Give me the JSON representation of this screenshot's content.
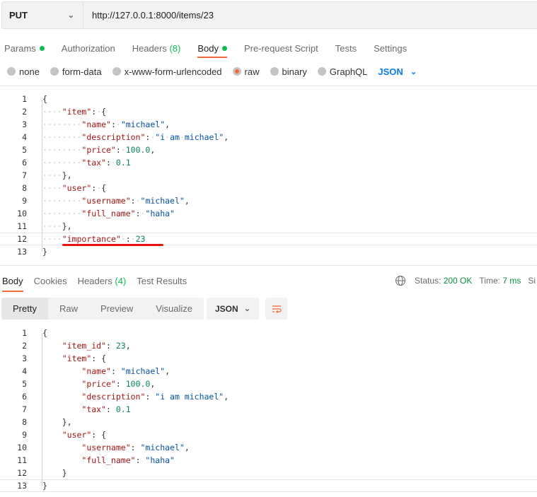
{
  "request": {
    "method": "PUT",
    "url": "http://127.0.0.1:8000/items/23"
  },
  "tabs": [
    {
      "label": "Params",
      "dot": true
    },
    {
      "label": "Authorization"
    },
    {
      "label": "Headers",
      "count": "(8)"
    },
    {
      "label": "Body",
      "dot": true,
      "active": true
    },
    {
      "label": "Pre-request Script"
    },
    {
      "label": "Tests"
    },
    {
      "label": "Settings"
    }
  ],
  "body_types": [
    {
      "label": "none"
    },
    {
      "label": "form-data"
    },
    {
      "label": "x-www-form-urlencoded"
    },
    {
      "label": "raw",
      "selected": true
    },
    {
      "label": "binary"
    },
    {
      "label": "GraphQL"
    }
  ],
  "body_format": "JSON",
  "request_body": [
    [
      [
        "p",
        "{"
      ]
    ],
    [
      [
        "k",
        "\"item\""
      ],
      [
        "p",
        ": {"
      ]
    ],
    [
      [
        "k",
        "\"name\""
      ],
      [
        "p",
        ": "
      ],
      [
        "s",
        "\"michael\""
      ],
      [
        "p",
        ","
      ]
    ],
    [
      [
        "k",
        "\"description\""
      ],
      [
        "p",
        ": "
      ],
      [
        "s",
        "\"i am michael\""
      ],
      [
        "p",
        ","
      ]
    ],
    [
      [
        "k",
        "\"price\""
      ],
      [
        "p",
        ": "
      ],
      [
        "n",
        "100.0"
      ],
      [
        "p",
        ","
      ]
    ],
    [
      [
        "k",
        "\"tax\""
      ],
      [
        "p",
        ": "
      ],
      [
        "n",
        "0.1"
      ]
    ],
    [
      [
        "p",
        "},"
      ]
    ],
    [
      [
        "k",
        "\"user\""
      ],
      [
        "p",
        ": {"
      ]
    ],
    [
      [
        "k",
        "\"username\""
      ],
      [
        "p",
        ": "
      ],
      [
        "s",
        "\"michael\""
      ],
      [
        "p",
        ","
      ]
    ],
    [
      [
        "k",
        "\"full_name\""
      ],
      [
        "p",
        ": "
      ],
      [
        "s",
        "\"haha\""
      ]
    ],
    [
      [
        "p",
        "},"
      ]
    ],
    [
      [
        "k",
        "\"importance\""
      ],
      [
        "p",
        " : "
      ],
      [
        "n",
        "23"
      ]
    ],
    [
      [
        "p",
        "}"
      ]
    ]
  ],
  "request_indent": [
    0,
    1,
    2,
    2,
    2,
    2,
    1,
    1,
    2,
    2,
    1,
    1,
    0
  ],
  "response_tabs": [
    {
      "label": "Body",
      "active": true
    },
    {
      "label": "Cookies"
    },
    {
      "label": "Headers",
      "count": "(4)"
    },
    {
      "label": "Test Results"
    }
  ],
  "status": {
    "status_label": "Status:",
    "status_value": "200 OK",
    "time_label": "Time:",
    "time_value": "7 ms",
    "size_label": "Si"
  },
  "view_modes": [
    "Pretty",
    "Raw",
    "Preview",
    "Visualize"
  ],
  "response_format": "JSON",
  "response_body": [
    [
      [
        "p",
        "{"
      ]
    ],
    [
      [
        "k",
        "\"item_id\""
      ],
      [
        "p",
        ": "
      ],
      [
        "n",
        "23"
      ],
      [
        "p",
        ","
      ]
    ],
    [
      [
        "k",
        "\"item\""
      ],
      [
        "p",
        ": {"
      ]
    ],
    [
      [
        "k",
        "\"name\""
      ],
      [
        "p",
        ": "
      ],
      [
        "s",
        "\"michael\""
      ],
      [
        "p",
        ","
      ]
    ],
    [
      [
        "k",
        "\"price\""
      ],
      [
        "p",
        ": "
      ],
      [
        "n",
        "100.0"
      ],
      [
        "p",
        ","
      ]
    ],
    [
      [
        "k",
        "\"description\""
      ],
      [
        "p",
        ": "
      ],
      [
        "s",
        "\"i am michael\""
      ],
      [
        "p",
        ","
      ]
    ],
    [
      [
        "k",
        "\"tax\""
      ],
      [
        "p",
        ": "
      ],
      [
        "n",
        "0.1"
      ]
    ],
    [
      [
        "p",
        "},"
      ]
    ],
    [
      [
        "k",
        "\"user\""
      ],
      [
        "p",
        ": {"
      ]
    ],
    [
      [
        "k",
        "\"username\""
      ],
      [
        "p",
        ": "
      ],
      [
        "s",
        "\"michael\""
      ],
      [
        "p",
        ","
      ]
    ],
    [
      [
        "k",
        "\"full_name\""
      ],
      [
        "p",
        ": "
      ],
      [
        "s",
        "\"haha\""
      ]
    ],
    [
      [
        "p",
        "}"
      ]
    ],
    [
      [
        "p",
        "}"
      ]
    ]
  ],
  "response_indent": [
    0,
    1,
    1,
    2,
    2,
    2,
    2,
    1,
    1,
    2,
    2,
    1,
    0
  ],
  "colors": {
    "accent": "#f26b3a",
    "green": "#0cbb52",
    "blue": "#097bed",
    "key": "#a31515",
    "string": "#0451a5",
    "number": "#098658"
  }
}
